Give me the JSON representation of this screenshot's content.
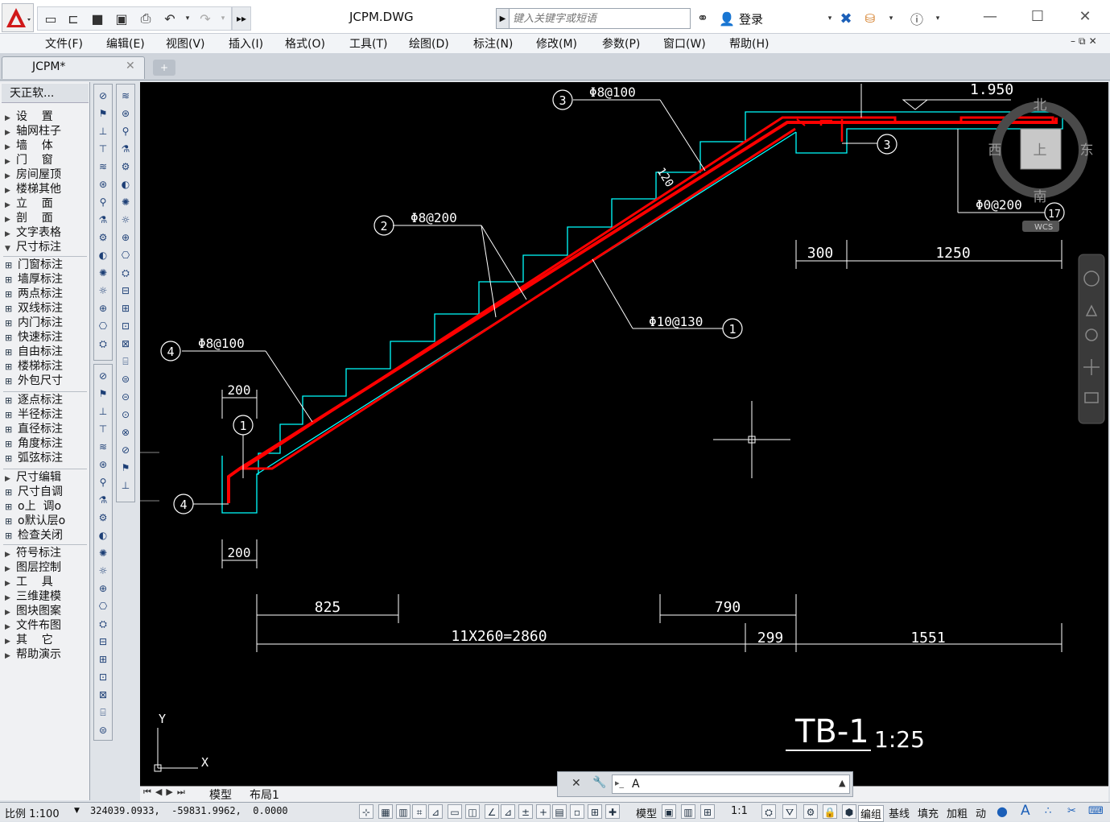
{
  "app": {
    "title": "JCPM.DWG",
    "search_placeholder": "键入关键字或短语",
    "login_label": "登录",
    "win_min": "—",
    "win_max": "☐",
    "win_close": "✕"
  },
  "menu": [
    "文件(F)",
    "编辑(E)",
    "视图(V)",
    "插入(I)",
    "格式(O)",
    "工具(T)",
    "绘图(D)",
    "标注(N)",
    "修改(M)",
    "参数(P)",
    "窗口(W)",
    "帮助(H)"
  ],
  "file_tab": {
    "label": "JCPM*",
    "close": "✕"
  },
  "side_menu": {
    "title": "天正软...",
    "groups": [
      [
        {
          "label": "设    置",
          "kind": "arrow"
        },
        {
          "label": "轴网柱子",
          "kind": "arrow"
        },
        {
          "label": "墙    体",
          "kind": "arrow"
        },
        {
          "label": "门    窗",
          "kind": "arrow"
        },
        {
          "label": "房间屋顶",
          "kind": "arrow"
        },
        {
          "label": "楼梯其他",
          "kind": "arrow"
        },
        {
          "label": "立    面",
          "kind": "arrow"
        },
        {
          "label": "剖    面",
          "kind": "arrow"
        },
        {
          "label": "文字表格",
          "kind": "arrow"
        },
        {
          "label": "尺寸标注",
          "kind": "open"
        }
      ],
      [
        {
          "label": "门窗标注",
          "kind": "icon"
        },
        {
          "label": "墙厚标注",
          "kind": "icon"
        },
        {
          "label": "两点标注",
          "kind": "icon"
        },
        {
          "label": "双线标注",
          "kind": "icon"
        },
        {
          "label": "内门标注",
          "kind": "icon"
        },
        {
          "label": "快速标注",
          "kind": "icon"
        },
        {
          "label": "自由标注",
          "kind": "icon"
        },
        {
          "label": "楼梯标注",
          "kind": "icon"
        },
        {
          "label": "外包尺寸",
          "kind": "icon"
        }
      ],
      [
        {
          "label": "逐点标注",
          "kind": "icon"
        },
        {
          "label": "半径标注",
          "kind": "icon"
        },
        {
          "label": "直径标注",
          "kind": "icon"
        },
        {
          "label": "角度标注",
          "kind": "icon"
        },
        {
          "label": "弧弦标注",
          "kind": "icon"
        }
      ],
      [
        {
          "label": "尺寸编辑",
          "kind": "arrow"
        },
        {
          "label": "尺寸自调",
          "kind": "icon"
        },
        {
          "label": "o上  调o",
          "kind": "icon"
        },
        {
          "label": "o默认层o",
          "kind": "icon"
        },
        {
          "label": "检查关闭",
          "kind": "icon"
        }
      ],
      [
        {
          "label": "符号标注",
          "kind": "arrow"
        },
        {
          "label": "图层控制",
          "kind": "arrow"
        },
        {
          "label": "工    具",
          "kind": "arrow"
        },
        {
          "label": "三维建模",
          "kind": "arrow"
        },
        {
          "label": "图块图案",
          "kind": "arrow"
        },
        {
          "label": "文件布图",
          "kind": "arrow"
        },
        {
          "label": "其    它",
          "kind": "arrow"
        },
        {
          "label": "帮助演示",
          "kind": "arrow"
        }
      ]
    ]
  },
  "drawing": {
    "elevation": "1.950",
    "labels": {
      "r3_top": "Φ8@100",
      "r2": "Φ8@200",
      "r4": "Φ8@100",
      "r1": "Φ10@130",
      "r17": "Φ0@200",
      "thick": "120"
    },
    "circles": {
      "c3a": "3",
      "c3b": "3",
      "c2": "2",
      "c4a": "4",
      "c4b": "4",
      "c1a": "1",
      "c1b": "1",
      "c17": "17"
    },
    "dims": {
      "d300": "300",
      "d1250": "1250",
      "d200a": "200",
      "d200b": "200",
      "d825": "825",
      "d790": "790",
      "d2860": "11X260=2860",
      "d299": "299",
      "d1551": "1551"
    },
    "title": "TB-1",
    "scale": "1:25",
    "compass": {
      "n": "北",
      "s": "南",
      "e": "东",
      "w": "西",
      "top": "上",
      "wcs": "WCS"
    },
    "ucs": {
      "x": "X",
      "y": "Y"
    }
  },
  "layout_tabs": {
    "model": "模型",
    "layout1": "布局1"
  },
  "command": {
    "text": "A",
    "close": "✕"
  },
  "status": {
    "scale": "比例 1:100",
    "coords": "324039.0933,  -59831.9962,  0.0000",
    "model": "模型",
    "anno_scale": "1:1",
    "buttons": [
      "编组",
      "基线",
      "填充",
      "加粗",
      "动"
    ]
  },
  "colors": {
    "rebar": "#ff0000",
    "concrete": "#00ffff",
    "annotation": "#ffffff",
    "canvas": "#000000"
  }
}
